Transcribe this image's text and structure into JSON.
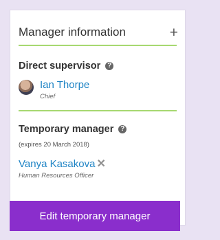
{
  "panel": {
    "title": "Manager information",
    "add_icon": "plus-icon"
  },
  "supervisor": {
    "label": "Direct supervisor",
    "help_icon": "question-circle-icon",
    "name": "Ian Thorpe",
    "role": "Chief"
  },
  "temporary": {
    "label": "Temporary manager",
    "help_icon": "question-circle-icon",
    "expires": "(expires 20 March 2018)",
    "name": "Vanya Kasakova",
    "role": "Human Resources Officer",
    "remove_icon": "close-icon"
  },
  "actions": {
    "edit_label": "Edit temporary manager"
  },
  "colors": {
    "accent": "#8a2ecc",
    "link": "#1f84c5",
    "divider": "#a7d871",
    "background": "#e9e2f3"
  }
}
